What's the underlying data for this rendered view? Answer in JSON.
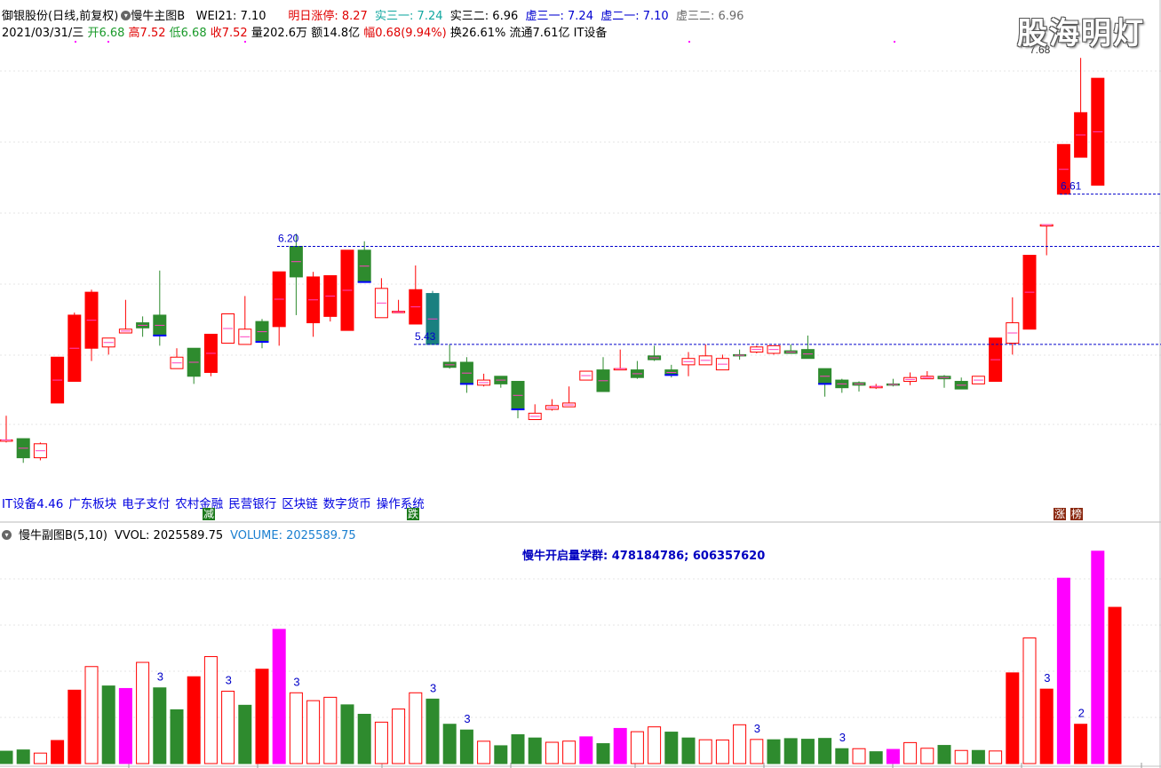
{
  "header": {
    "stock_name": "御银股份(日线,前复权)",
    "main_indicator": "慢牛主图B",
    "wei21": "WEI21: 7.10",
    "next_limit": "明日涨停: 8.27",
    "real31": "实三一: 7.24",
    "real32": "实三二: 6.96",
    "virt31": "虚三一: 7.24",
    "virt21": "虚二一: 7.10",
    "virt32": "虚三二: 6.96",
    "date": "2021/03/31/三",
    "open": "开6.68",
    "high": "高7.52",
    "low": "低6.68",
    "close": "收7.52",
    "volume": "量202.6万",
    "amount": "额14.8亿",
    "change": "幅0.68(9.94%)",
    "turnover": "换26.61%",
    "float": "流通7.61亿",
    "sector": "IT设备"
  },
  "watermark": "股海明灯",
  "concepts": [
    "IT设备4.46",
    "广东板块",
    "电子支付",
    "农村金融",
    "民营银行",
    "区块链",
    "数字货币",
    "操作系统"
  ],
  "signals": {
    "jian": "减",
    "die": "跌",
    "zhang": "涨",
    "bang": "榜"
  },
  "sub_header": {
    "name": "慢牛副图B(5,10)",
    "vvol": "VVOL: 2025589.75",
    "volume": "VOLUME: 2025589.75"
  },
  "volume_note": "慢牛开启量学群: 478184786; 606357620",
  "colors": {
    "up": "#ff0000",
    "down": "#2e8b2e",
    "magenta": "#ff00ff",
    "teal": "#1a8080",
    "level": "#0000cc"
  },
  "chart_data": {
    "type": "candlestick",
    "price_range": [
      4.3,
      7.8
    ],
    "levels": [
      {
        "value": 6.2,
        "label": "6.20"
      },
      {
        "value": 5.43,
        "label": "5.43"
      },
      {
        "value": 6.61,
        "label": "6.61"
      },
      {
        "value": 7.68,
        "label": "7.68"
      }
    ],
    "candles": [
      {
        "o": 4.68,
        "h": 4.87,
        "l": 4.66,
        "c": 4.68
      },
      {
        "o": 4.69,
        "h": 4.69,
        "l": 4.5,
        "c": 4.54
      },
      {
        "o": 4.54,
        "h": 4.66,
        "l": 4.52,
        "c": 4.65
      },
      {
        "o": 4.97,
        "h": 5.33,
        "l": 4.97,
        "c": 5.33
      },
      {
        "o": 5.14,
        "h": 5.68,
        "l": 5.14,
        "c": 5.66
      },
      {
        "o": 5.4,
        "h": 5.86,
        "l": 5.3,
        "c": 5.84
      },
      {
        "o": 5.41,
        "h": 5.4,
        "l": 5.35,
        "c": 5.48
      },
      {
        "o": 5.52,
        "h": 5.78,
        "l": 5.53,
        "c": 5.55
      },
      {
        "o": 5.6,
        "h": 5.65,
        "l": 5.49,
        "c": 5.56
      },
      {
        "o": 5.66,
        "h": 6.01,
        "l": 5.42,
        "c": 5.5
      },
      {
        "o": 5.24,
        "h": 5.4,
        "l": 5.37,
        "c": 5.33
      },
      {
        "o": 5.4,
        "h": 5.4,
        "l": 5.12,
        "c": 5.18
      },
      {
        "o": 5.21,
        "h": 5.32,
        "l": 5.18,
        "c": 5.51
      },
      {
        "o": 5.44,
        "h": 5.51,
        "l": 5.49,
        "c": 5.67
      },
      {
        "o": 5.43,
        "h": 5.81,
        "l": 5.44,
        "c": 5.55
      },
      {
        "o": 5.61,
        "h": 5.63,
        "l": 5.4,
        "c": 5.45
      },
      {
        "o": 5.57,
        "h": 5.64,
        "l": 5.42,
        "c": 6.0
      },
      {
        "o": 6.2,
        "h": 6.3,
        "l": 5.66,
        "c": 5.96
      },
      {
        "o": 5.6,
        "h": 6.0,
        "l": 5.49,
        "c": 5.96
      },
      {
        "o": 5.65,
        "h": 5.8,
        "l": 5.61,
        "c": 5.97
      },
      {
        "o": 5.54,
        "h": 6.09,
        "l": 5.72,
        "c": 6.17
      },
      {
        "o": 6.17,
        "h": 6.24,
        "l": 5.92,
        "c": 5.92
      },
      {
        "o": 5.64,
        "h": 5.95,
        "l": 5.71,
        "c": 5.87
      },
      {
        "o": 5.68,
        "h": 5.78,
        "l": 5.72,
        "c": 5.69
      },
      {
        "o": 5.59,
        "h": 6.05,
        "l": 5.65,
        "c": 5.86
      },
      {
        "o": 5.83,
        "h": 5.85,
        "l": 5.43,
        "c": 5.43
      },
      {
        "o": 5.29,
        "h": 5.43,
        "l": 5.24,
        "c": 5.25
      },
      {
        "o": 5.29,
        "h": 5.33,
        "l": 5.05,
        "c": 5.12
      },
      {
        "o": 5.11,
        "h": 5.2,
        "l": 5.1,
        "c": 5.15
      },
      {
        "o": 5.18,
        "h": 5.13,
        "l": 5.09,
        "c": 5.12
      },
      {
        "o": 5.14,
        "h": 5.1,
        "l": 4.85,
        "c": 4.92
      },
      {
        "o": 4.84,
        "h": 4.96,
        "l": 4.84,
        "c": 4.89
      },
      {
        "o": 4.92,
        "h": 5.0,
        "l": 4.91,
        "c": 4.95
      },
      {
        "o": 4.94,
        "h": 5.1,
        "l": 5.0,
        "c": 4.97
      },
      {
        "o": 5.15,
        "h": 5.2,
        "l": 5.15,
        "c": 5.22
      },
      {
        "o": 5.23,
        "h": 5.33,
        "l": 5.12,
        "c": 5.06
      },
      {
        "o": 5.24,
        "h": 5.39,
        "l": 5.23,
        "c": 5.24
      },
      {
        "o": 5.23,
        "h": 5.3,
        "l": 5.16,
        "c": 5.17
      },
      {
        "o": 5.34,
        "h": 5.42,
        "l": 5.3,
        "c": 5.31
      },
      {
        "o": 5.23,
        "h": 5.27,
        "l": 5.17,
        "c": 5.19
      },
      {
        "o": 5.27,
        "h": 5.37,
        "l": 5.18,
        "c": 5.32
      },
      {
        "o": 5.27,
        "h": 5.43,
        "l": 5.29,
        "c": 5.34
      },
      {
        "o": 5.23,
        "h": 5.35,
        "l": 5.23,
        "c": 5.32
      },
      {
        "o": 5.35,
        "h": 5.39,
        "l": 5.31,
        "c": 5.34
      },
      {
        "o": 5.37,
        "h": 5.42,
        "l": 5.36,
        "c": 5.41
      },
      {
        "o": 5.36,
        "h": 5.42,
        "l": 5.35,
        "c": 5.42
      },
      {
        "o": 5.38,
        "h": 5.43,
        "l": 5.37,
        "c": 5.36
      },
      {
        "o": 5.39,
        "h": 5.5,
        "l": 5.4,
        "c": 5.32
      },
      {
        "o": 5.24,
        "h": 5.23,
        "l": 5.02,
        "c": 5.12
      },
      {
        "o": 5.15,
        "h": 5.16,
        "l": 5.05,
        "c": 5.09
      },
      {
        "o": 5.13,
        "h": 5.14,
        "l": 5.06,
        "c": 5.11
      },
      {
        "o": 5.1,
        "h": 5.12,
        "l": 5.08,
        "c": 5.1
      },
      {
        "o": 5.12,
        "h": 5.16,
        "l": 5.1,
        "c": 5.11
      },
      {
        "o": 5.14,
        "h": 5.21,
        "l": 5.11,
        "c": 5.17
      },
      {
        "o": 5.16,
        "h": 5.22,
        "l": 5.16,
        "c": 5.18
      },
      {
        "o": 5.18,
        "h": 5.19,
        "l": 5.09,
        "c": 5.16
      },
      {
        "o": 5.14,
        "h": 5.17,
        "l": 5.1,
        "c": 5.08
      },
      {
        "o": 5.12,
        "h": 5.15,
        "l": 5.12,
        "c": 5.18
      },
      {
        "o": 5.14,
        "h": 5.37,
        "l": 5.14,
        "c": 5.48
      },
      {
        "o": 5.44,
        "h": 5.8,
        "l": 5.35,
        "c": 5.6
      },
      {
        "o": 5.55,
        "h": 6.13,
        "l": 5.55,
        "c": 6.13
      },
      {
        "o": 6.37,
        "h": 6.37,
        "l": 6.13,
        "c": 6.37
      },
      {
        "o": 6.61,
        "h": 7.0,
        "l": 6.61,
        "c": 7.0
      },
      {
        "o": 6.9,
        "h": 7.68,
        "l": 6.9,
        "c": 7.25
      },
      {
        "o": 6.68,
        "h": 7.52,
        "l": 6.68,
        "c": 7.52
      }
    ],
    "volume_range": [
      0,
      2100000
    ],
    "volumes": [
      {
        "v": 118000,
        "s": "green"
      },
      {
        "v": 130000,
        "s": "green"
      },
      {
        "v": 100000,
        "s": "hollow"
      },
      {
        "v": 220000,
        "s": "red"
      },
      {
        "v": 700000,
        "s": "red"
      },
      {
        "v": 925000,
        "s": "hollow"
      },
      {
        "v": 740000,
        "s": "green"
      },
      {
        "v": 716000,
        "s": "magenta"
      },
      {
        "v": 965000,
        "s": "hollow"
      },
      {
        "v": 722000,
        "s": "green"
      },
      {
        "v": 513000,
        "s": "green"
      },
      {
        "v": 828000,
        "s": "red"
      },
      {
        "v": 1020000,
        "s": "hollow"
      },
      {
        "v": 690000,
        "s": "hollow"
      },
      {
        "v": 556000,
        "s": "green"
      },
      {
        "v": 900000,
        "s": "red"
      },
      {
        "v": 1280000,
        "s": "magenta"
      },
      {
        "v": 675000,
        "s": "hollow"
      },
      {
        "v": 600000,
        "s": "hollow"
      },
      {
        "v": 632000,
        "s": "hollow"
      },
      {
        "v": 560000,
        "s": "green"
      },
      {
        "v": 470000,
        "s": "green"
      },
      {
        "v": 395000,
        "s": "hollow"
      },
      {
        "v": 520000,
        "s": "hollow"
      },
      {
        "v": 675000,
        "s": "hollow"
      },
      {
        "v": 615000,
        "s": "green"
      },
      {
        "v": 375000,
        "s": "green"
      },
      {
        "v": 320000,
        "s": "green"
      },
      {
        "v": 213000,
        "s": "hollow"
      },
      {
        "v": 170000,
        "s": "green"
      },
      {
        "v": 275000,
        "s": "green"
      },
      {
        "v": 244000,
        "s": "green"
      },
      {
        "v": 203000,
        "s": "hollow"
      },
      {
        "v": 214000,
        "s": "hollow"
      },
      {
        "v": 255000,
        "s": "magenta"
      },
      {
        "v": 190000,
        "s": "green"
      },
      {
        "v": 335000,
        "s": "magenta"
      },
      {
        "v": 304000,
        "s": "hollow"
      },
      {
        "v": 350000,
        "s": "hollow"
      },
      {
        "v": 300000,
        "s": "green"
      },
      {
        "v": 244000,
        "s": "green"
      },
      {
        "v": 227000,
        "s": "hollow"
      },
      {
        "v": 225000,
        "s": "hollow"
      },
      {
        "v": 370000,
        "s": "hollow"
      },
      {
        "v": 230000,
        "s": "hollow"
      },
      {
        "v": 227000,
        "s": "green"
      },
      {
        "v": 238000,
        "s": "green"
      },
      {
        "v": 232000,
        "s": "green"
      },
      {
        "v": 240000,
        "s": "green"
      },
      {
        "v": 142000,
        "s": "green"
      },
      {
        "v": 142000,
        "s": "hollow"
      },
      {
        "v": 113000,
        "s": "green"
      },
      {
        "v": 135000,
        "s": "magenta"
      },
      {
        "v": 200000,
        "s": "hollow"
      },
      {
        "v": 146000,
        "s": "hollow"
      },
      {
        "v": 173000,
        "s": "green"
      },
      {
        "v": 125000,
        "s": "hollow"
      },
      {
        "v": 125000,
        "s": "green"
      },
      {
        "v": 120000,
        "s": "hollow"
      },
      {
        "v": 865000,
        "s": "red"
      },
      {
        "v": 1198000,
        "s": "hollow"
      },
      {
        "v": 710000,
        "s": "red"
      },
      {
        "v": 1768000,
        "s": "magenta"
      },
      {
        "v": 375000,
        "s": "red"
      },
      {
        "v": 2025590,
        "s": "magenta"
      },
      {
        "v": 1490000,
        "s": "red"
      }
    ],
    "volume_markers": [
      {
        "index": 9,
        "label": "3"
      },
      {
        "index": 13,
        "label": "3"
      },
      {
        "index": 17,
        "label": "3"
      },
      {
        "index": 25,
        "label": "3"
      },
      {
        "index": 27,
        "label": "3"
      },
      {
        "index": 44,
        "label": "3"
      },
      {
        "index": 49,
        "label": "3"
      },
      {
        "index": 61,
        "label": "3"
      },
      {
        "index": 63,
        "label": "2"
      }
    ]
  }
}
